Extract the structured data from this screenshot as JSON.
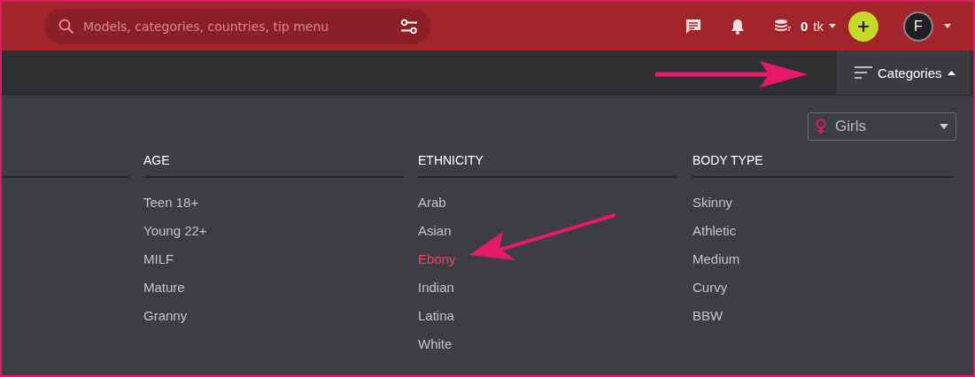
{
  "header": {
    "search": {
      "placeholder": "Models, categories, countries, tip menu"
    },
    "tokens": {
      "amount": "0",
      "unit": "tk"
    },
    "avatar": {
      "initial": "F"
    }
  },
  "toolbar": {
    "categories_button": {
      "label": "Categories",
      "expanded": true
    }
  },
  "gender_select": {
    "value": "Girls"
  },
  "columns": [
    {
      "heading": "AGE",
      "items": [
        {
          "label": "Teen 18+",
          "selected": false
        },
        {
          "label": "Young 22+",
          "selected": false
        },
        {
          "label": "MILF",
          "selected": false
        },
        {
          "label": "Mature",
          "selected": false
        },
        {
          "label": "Granny",
          "selected": false
        }
      ]
    },
    {
      "heading": "ETHNICITY",
      "items": [
        {
          "label": "Arab",
          "selected": false
        },
        {
          "label": "Asian",
          "selected": false
        },
        {
          "label": "Ebony",
          "selected": true
        },
        {
          "label": "Indian",
          "selected": false
        },
        {
          "label": "Latina",
          "selected": false
        },
        {
          "label": "White",
          "selected": false
        }
      ]
    },
    {
      "heading": "BODY TYPE",
      "items": [
        {
          "label": "Skinny",
          "selected": false
        },
        {
          "label": "Athletic",
          "selected": false
        },
        {
          "label": "Medium",
          "selected": false
        },
        {
          "label": "Curvy",
          "selected": false
        },
        {
          "label": "BBW",
          "selected": false
        }
      ]
    }
  ]
}
